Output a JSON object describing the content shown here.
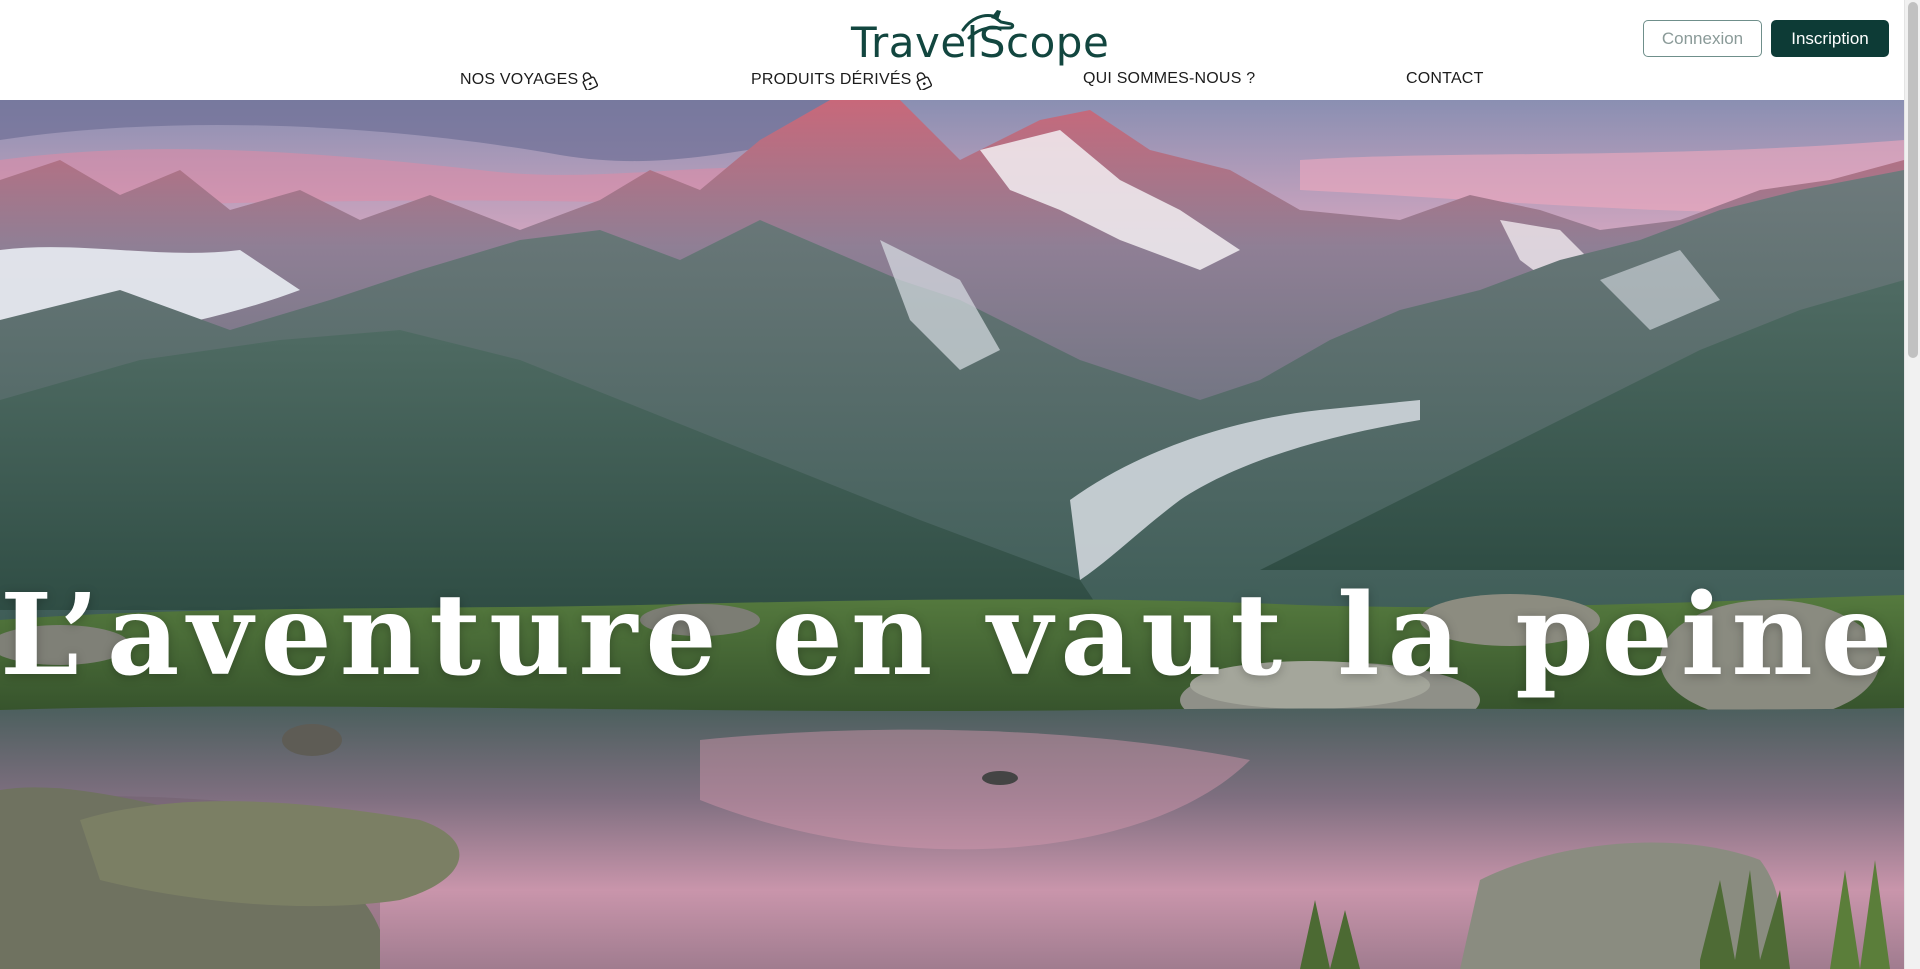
{
  "header": {
    "logo_text": "TravelScope",
    "login_label": "Connexion",
    "signup_label": "Inscription"
  },
  "nav": {
    "items": [
      {
        "label": "NOS VOYAGES",
        "icon": "lock-icon"
      },
      {
        "label": "PRODUITS DÉRIVÉS",
        "icon": "lock-icon"
      },
      {
        "label": "QUI SOMMES-NOUS ?"
      },
      {
        "label": "CONTACT"
      }
    ]
  },
  "hero": {
    "title": "L’aventure en vaut la peine.",
    "image": "mountain-lake-landscape"
  },
  "colors": {
    "brand": "#0d3b36",
    "logo": "#12463f",
    "nav_text": "#1c1c1c"
  }
}
